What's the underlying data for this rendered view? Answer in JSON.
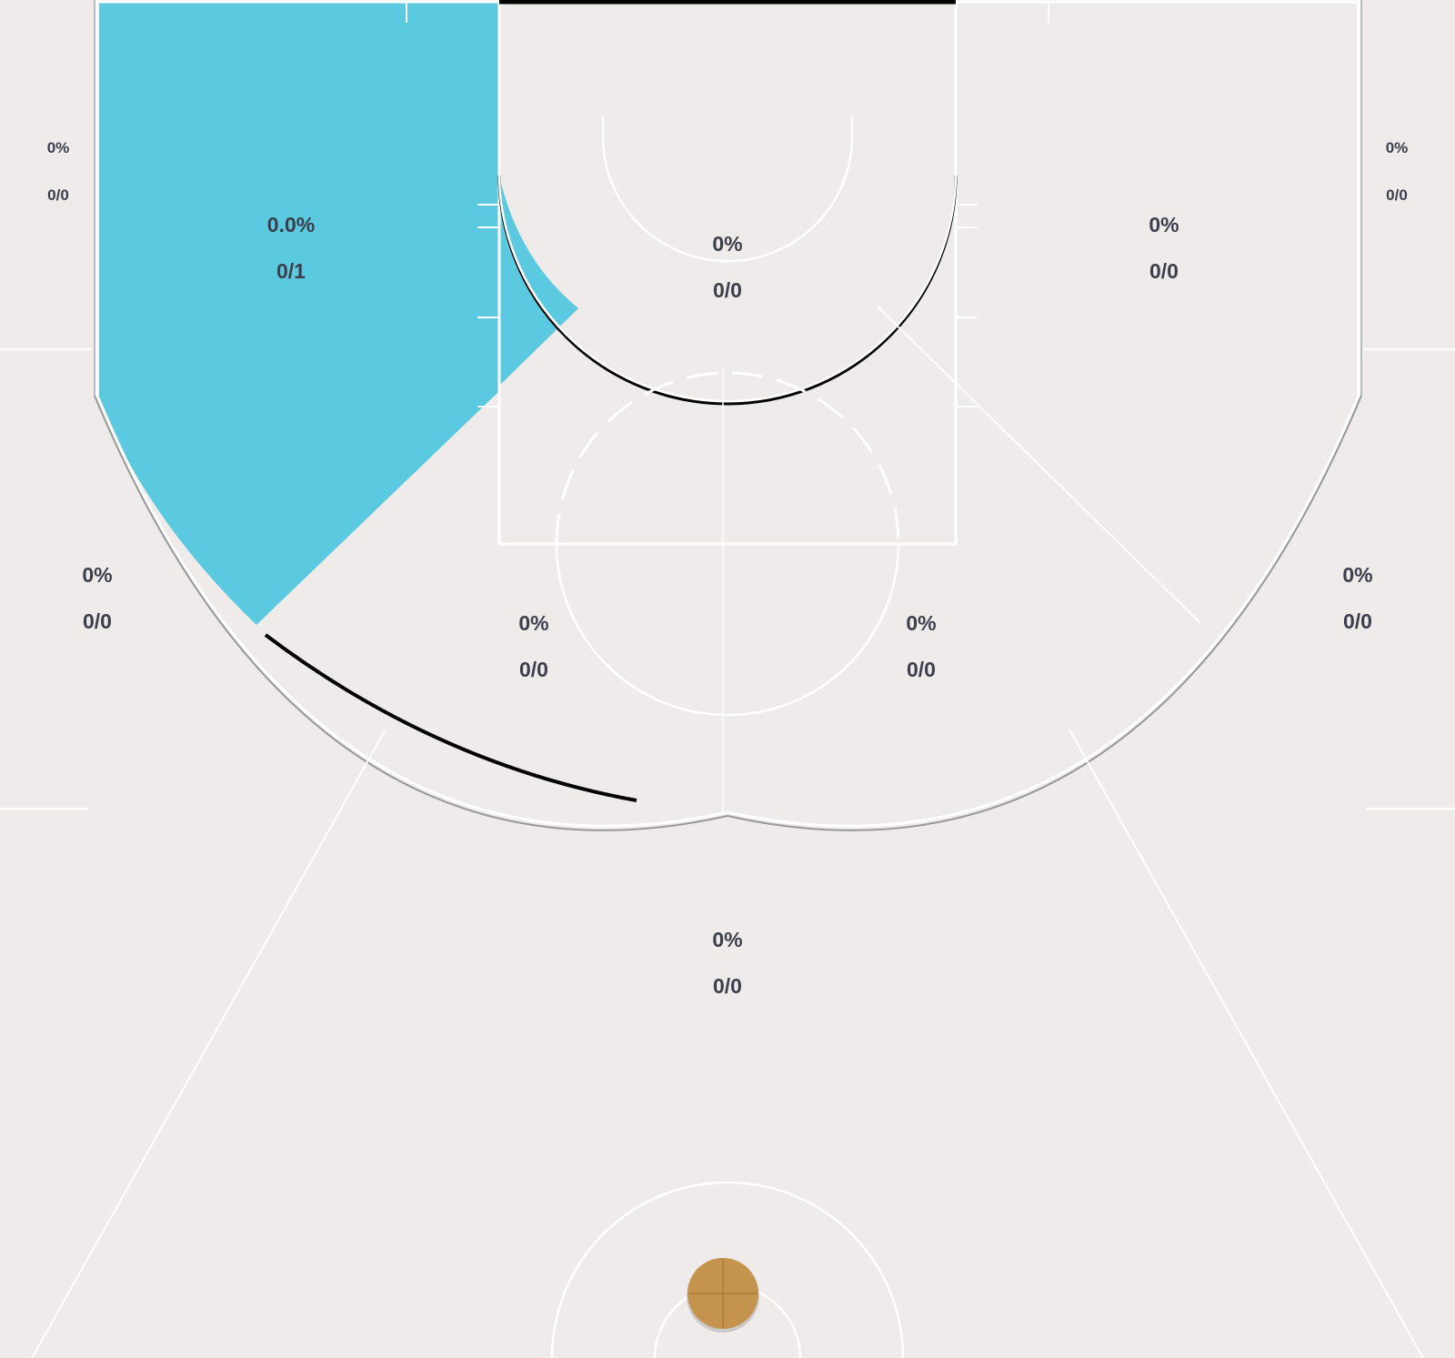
{
  "colors": {
    "court_bg": "#efebeb",
    "lines": "#ffffff",
    "highlight_zone": "#5bc9df",
    "label_text": "#3c3f4b",
    "ball": "#c4944f"
  },
  "zones": [
    {
      "id": "corner-left",
      "pct": "0%",
      "shots": "0/0"
    },
    {
      "id": "corner-right",
      "pct": "0%",
      "shots": "0/0"
    },
    {
      "id": "midrange-left-baseline",
      "pct": "0.0%",
      "shots": "0/1"
    },
    {
      "id": "paint",
      "pct": "0%",
      "shots": "0/0"
    },
    {
      "id": "midrange-right-baseline",
      "pct": "0%",
      "shots": "0/0"
    },
    {
      "id": "three-left-wing",
      "pct": "0%",
      "shots": "0/0"
    },
    {
      "id": "midrange-left-elbow",
      "pct": "0%",
      "shots": "0/0"
    },
    {
      "id": "midrange-right-elbow",
      "pct": "0%",
      "shots": "0/0"
    },
    {
      "id": "three-right-wing",
      "pct": "0%",
      "shots": "0/0"
    },
    {
      "id": "three-top",
      "pct": "0%",
      "shots": "0/0"
    }
  ],
  "ball_icon": "basketball-icon"
}
